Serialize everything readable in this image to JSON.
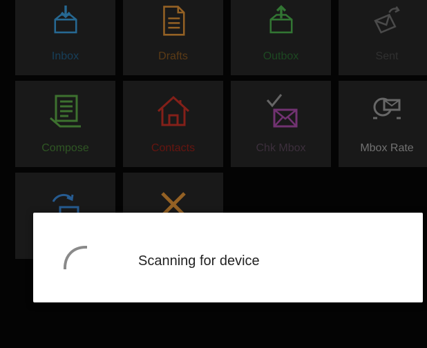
{
  "tiles": [
    {
      "label": "Inbox",
      "icon": "inbox-icon",
      "color": "#2f7fb3"
    },
    {
      "label": "Drafts",
      "icon": "drafts-icon",
      "color": "#b5772c"
    },
    {
      "label": "Outbox",
      "icon": "outbox-icon",
      "color": "#3d8f3f"
    },
    {
      "label": "Sent",
      "icon": "sent-icon",
      "color": "#5b5b5b"
    },
    {
      "label": "Compose",
      "icon": "compose-icon",
      "color": "#4b8a3a"
    },
    {
      "label": "Contacts",
      "icon": "contacts-icon",
      "color": "#a2281f"
    },
    {
      "label": "Chk Mbox",
      "icon": "check-mbox-icon",
      "color": "#8a3d8a"
    },
    {
      "label": "Mbox Rate",
      "icon": "mbox-rate-icon",
      "color": "#7e7e7e"
    },
    {
      "label": "",
      "icon": "sync-mail-icon",
      "color": "#2f6fb0"
    },
    {
      "label": "",
      "icon": "delete-icon",
      "color": "#b5772c"
    }
  ],
  "dialog": {
    "message": "Scanning for device",
    "spinner_color": "#8a8a8a"
  }
}
